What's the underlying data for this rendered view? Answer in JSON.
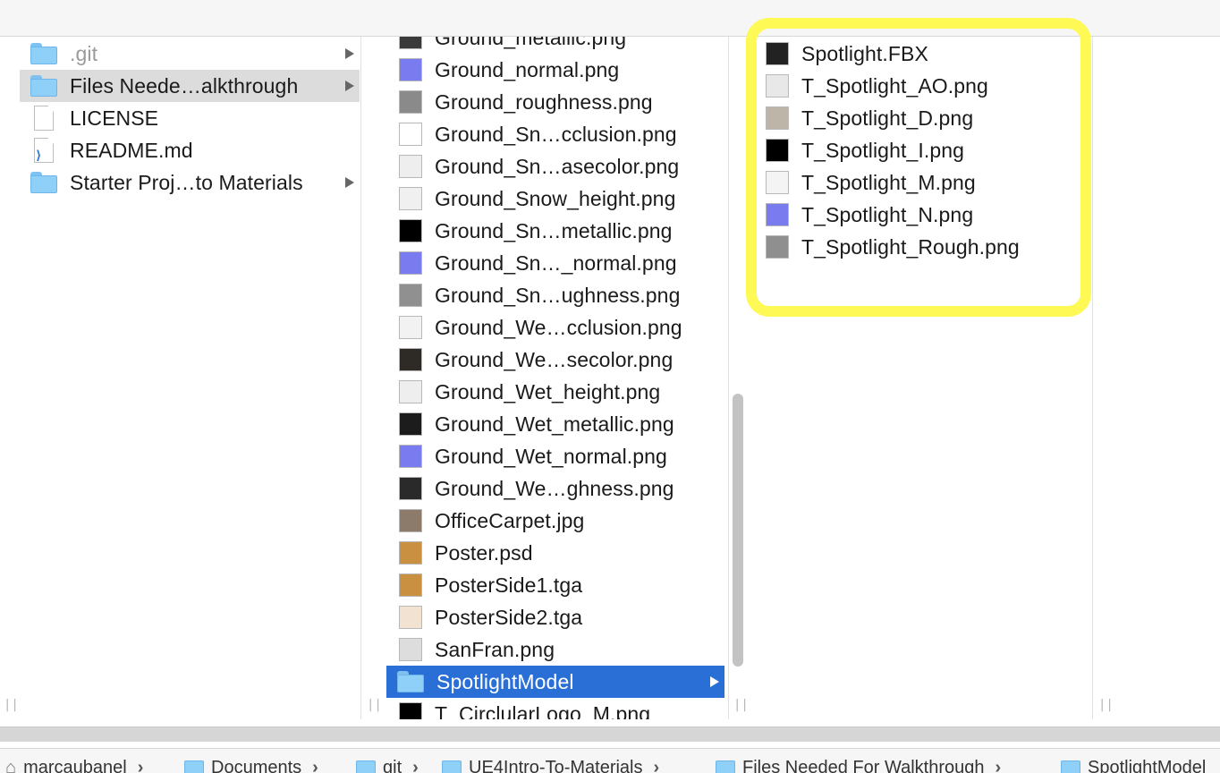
{
  "column1": {
    "items": [
      {
        "name": ".git",
        "type": "folder",
        "arrow": true,
        "dim": true
      },
      {
        "name": "Files Neede…alkthrough",
        "type": "folder",
        "arrow": true,
        "selected": true
      },
      {
        "name": "LICENSE",
        "type": "document"
      },
      {
        "name": "README.md",
        "type": "vscode-document"
      },
      {
        "name": "Starter Proj…to Materials",
        "type": "folder",
        "arrow": true
      }
    ]
  },
  "column2": {
    "items": [
      {
        "name": "Ground_metallic.png",
        "thumb": "#3a3a3a"
      },
      {
        "name": "Ground_normal.png",
        "thumb": "#7b7bf0"
      },
      {
        "name": "Ground_roughness.png",
        "thumb": "#8a8a8a"
      },
      {
        "name": "Ground_Sn…cclusion.png",
        "thumb": "#ffffff"
      },
      {
        "name": "Ground_Sn…asecolor.png",
        "thumb": "#eeeeee"
      },
      {
        "name": "Ground_Snow_height.png",
        "thumb": "#f0f0f0"
      },
      {
        "name": "Ground_Sn…metallic.png",
        "thumb": "#000000"
      },
      {
        "name": "Ground_Sn…_normal.png",
        "thumb": "#7b7bf0"
      },
      {
        "name": "Ground_Sn…ughness.png",
        "thumb": "#909090"
      },
      {
        "name": "Ground_We…cclusion.png",
        "thumb": "#f2f2f2"
      },
      {
        "name": "Ground_We…secolor.png",
        "thumb": "#2e2a26"
      },
      {
        "name": "Ground_Wet_height.png",
        "thumb": "#eeeeee"
      },
      {
        "name": "Ground_Wet_metallic.png",
        "thumb": "#1c1c1c"
      },
      {
        "name": "Ground_Wet_normal.png",
        "thumb": "#7b7bf0"
      },
      {
        "name": "Ground_We…ghness.png",
        "thumb": "#2a2a2a"
      },
      {
        "name": "OfficeCarpet.jpg",
        "thumb": "#8c7a6a"
      },
      {
        "name": "Poster.psd",
        "thumb": "#c89040"
      },
      {
        "name": "PosterSide1.tga",
        "thumb": "#c89040"
      },
      {
        "name": "PosterSide2.tga",
        "thumb": "#f1e2d2"
      },
      {
        "name": "SanFran.png",
        "thumb": "#dddddd"
      },
      {
        "name": "SpotlightModel",
        "folder": true,
        "selected": true
      },
      {
        "name": "T_CirclularLogo_M.png",
        "thumb": "#000000"
      }
    ]
  },
  "column3": {
    "items": [
      {
        "name": "Spotlight.FBX",
        "thumb": "#222222"
      },
      {
        "name": "T_Spotlight_AO.png",
        "thumb": "#e8e8e8"
      },
      {
        "name": "T_Spotlight_D.png",
        "thumb": "#bdb5a8"
      },
      {
        "name": "T_Spotlight_I.png",
        "thumb": "#000000"
      },
      {
        "name": "T_Spotlight_M.png",
        "thumb": "#f4f4f4"
      },
      {
        "name": "T_Spotlight_N.png",
        "thumb": "#7b7bf0"
      },
      {
        "name": "T_Spotlight_Rough.png",
        "thumb": "#8f8f8f"
      }
    ]
  },
  "pathbar": {
    "crumbs": [
      "marcaubanel",
      "Documents",
      "git",
      "UE4Intro-To-Materials",
      "Files Needed For Walkthrough",
      "SpotlightModel"
    ]
  },
  "colors": {
    "selection_blue": "#2a6fd6",
    "selection_gray": "#dcdcdc",
    "highlight_yellow": "#fff955"
  }
}
